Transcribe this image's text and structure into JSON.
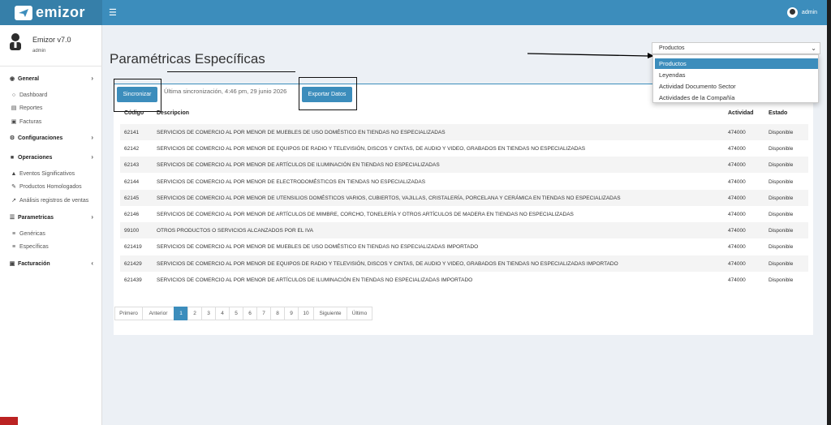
{
  "topbar": {
    "brand": "emizor",
    "user": "admin"
  },
  "sidebar": {
    "app_name": "Emizor v7.0",
    "role": "admin",
    "groups": [
      {
        "label": "General",
        "items": [
          "Dashboard",
          "Reportes",
          "Facturas"
        ]
      },
      {
        "label": "Configuraciones",
        "items": []
      },
      {
        "label": "Operaciones",
        "items": [
          "Eventos Significativos",
          "Productos Homologados",
          "Análisis registros de ventas"
        ]
      },
      {
        "label": "Parametricas",
        "items": [
          "Genéricas",
          "Específicas"
        ]
      },
      {
        "label": "Facturación",
        "items": []
      }
    ]
  },
  "page": {
    "title": "Paramétricas Específicas",
    "select_value": "Productos",
    "dropdown_options": [
      "Productos",
      "Leyendas",
      "Actividad Documento Sector",
      "Actividades de la Compañía"
    ],
    "sync_button": "Sincronizar",
    "sync_text": "Última sincronización, 4:46 pm, 29 junio 2026",
    "export_button": "Exportar Datos"
  },
  "table": {
    "headers": [
      "Código",
      "Descripcion",
      "Actividad",
      "Estado"
    ],
    "rows": [
      [
        "62141",
        "SERVICIOS DE COMERCIO AL POR MENOR DE MUEBLES DE USO DOMÉSTICO EN TIENDAS NO ESPECIALIZADAS",
        "474000",
        "Disponible"
      ],
      [
        "62142",
        "SERVICIOS DE COMERCIO AL POR MENOR DE EQUIPOS DE RADIO Y TELEVISIÓN, DISCOS Y CINTAS, DE AUDIO Y VIDEO, GRABADOS EN TIENDAS NO ESPECIALIZADAS",
        "474000",
        "Disponible"
      ],
      [
        "62143",
        "SERVICIOS DE COMERCIO AL POR MENOR DE ARTÍCULOS DE ILUMINACIÓN EN TIENDAS NO ESPECIALIZADAS",
        "474000",
        "Disponible"
      ],
      [
        "62144",
        "SERVICIOS DE COMERCIO AL POR MENOR DE ELECTRODOMÉSTICOS EN TIENDAS NO ESPECIALIZADAS",
        "474000",
        "Disponible"
      ],
      [
        "62145",
        "SERVICIOS DE COMERCIO AL POR MENOR DE UTENSILIOS DOMÉSTICOS VARIOS, CUBIERTOS, VAJILLAS, CRISTALERÍA, PORCELANA Y CERÁMICA EN TIENDAS NO ESPECIALIZADAS",
        "474000",
        "Disponible"
      ],
      [
        "62146",
        "SERVICIOS DE COMERCIO AL POR MENOR DE ARTÍCULOS DE MIMBRE, CORCHO, TONELERÍA Y OTROS ARTÍCULOS DE MADERA EN TIENDAS NO ESPECIALIZADAS",
        "474000",
        "Disponible"
      ],
      [
        "99100",
        "OTROS PRODUCTOS O SERVICIOS ALCANZADOS POR EL IVA",
        "474000",
        "Disponible"
      ],
      [
        "621419",
        "SERVICIOS DE COMERCIO AL POR MENOR DE MUEBLES DE USO DOMÉSTICO EN TIENDAS NO ESPECIALIZADAS IMPORTADO",
        "474000",
        "Disponible"
      ],
      [
        "621429",
        "SERVICIOS DE COMERCIO AL POR MENOR DE EQUIPOS DE RADIO Y TELEVISIÓN, DISCOS Y CINTAS, DE AUDIO Y VIDEO, GRABADOS EN TIENDAS NO ESPECIALIZADAS IMPORTADO",
        "474000",
        "Disponible"
      ],
      [
        "621439",
        "SERVICIOS DE COMERCIO AL POR MENOR DE ARTÍCULOS DE ILUMINACIÓN EN TIENDAS NO ESPECIALIZADAS IMPORTADO",
        "474000",
        "Disponible"
      ]
    ]
  },
  "pagination": {
    "first": "Primero",
    "prev": "Anterior",
    "pages": [
      "1",
      "2",
      "3",
      "4",
      "5",
      "6",
      "7",
      "8",
      "9",
      "10"
    ],
    "active_page": "1",
    "next": "Siguiente",
    "last": "Último"
  },
  "colors": {
    "primary": "#3c8dbc",
    "brand_dark": "#367fa9",
    "content_bg": "#ecf0f5"
  }
}
